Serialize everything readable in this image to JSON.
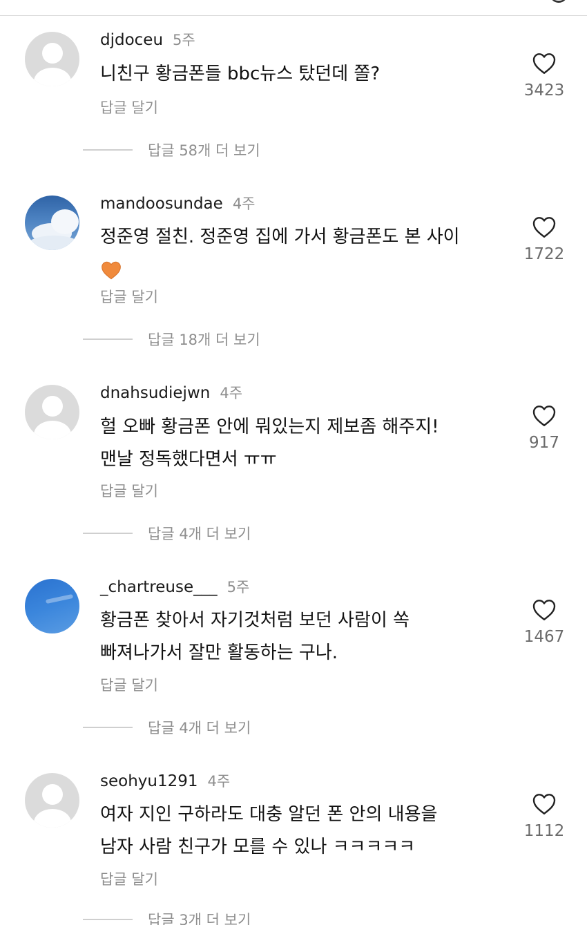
{
  "comments": [
    {
      "username": "djdoceu",
      "ago": "5주",
      "lines": [
        "니친구 황금폰들 bbc뉴스 탔던데 쫄?"
      ],
      "reply_label": "답글 달기",
      "likes": "3423",
      "more_replies": "답글 58개 더 보기",
      "avatar": "default-avatar"
    },
    {
      "username": "mandoosundae",
      "ago": "4주",
      "lines": [
        "정준영 절친. 정준영 집에 가서 황금폰도 본 사이"
      ],
      "emoji": "orange-heart-emoji",
      "reply_label": "답글 달기",
      "likes": "1722",
      "more_replies": "답글 18개 더 보기",
      "avatar": "clouds-avatar"
    },
    {
      "username": "dnahsudiejwn",
      "ago": "4주",
      "lines": [
        "헐 오빠 황금폰 안에 뭐있는지 제보좀 해주지!",
        "맨날 정독했다면서 ㅠㅠ"
      ],
      "reply_label": "답글 달기",
      "likes": "917",
      "more_replies": "답글 4개 더 보기",
      "avatar": "default-avatar"
    },
    {
      "username": "_chartreuse___",
      "ago": "5주",
      "lines": [
        "황금폰 찾아서 자기것처럼 보던 사람이 쏙",
        "빠져나가서 잘만 활동하는 구나."
      ],
      "reply_label": "답글 달기",
      "likes": "1467",
      "more_replies": "답글 4개 더 보기",
      "avatar": "sky-avatar"
    },
    {
      "username": "seohyu1291",
      "ago": "4주",
      "lines": [
        "여자 지인 구하라도 대충 알던 폰 안의 내용을",
        "남자 사람 친구가 모를 수 있나 ㅋㅋㅋㅋㅋ"
      ],
      "reply_label": "답글 달기",
      "likes": "1112",
      "more_replies": "답글 3개 더 보기",
      "avatar": "default-avatar"
    }
  ],
  "colors": {
    "muted_text": "#8e8e8e",
    "like_count": "#6b6b6b",
    "heart_emoji": "#f08a3c"
  }
}
